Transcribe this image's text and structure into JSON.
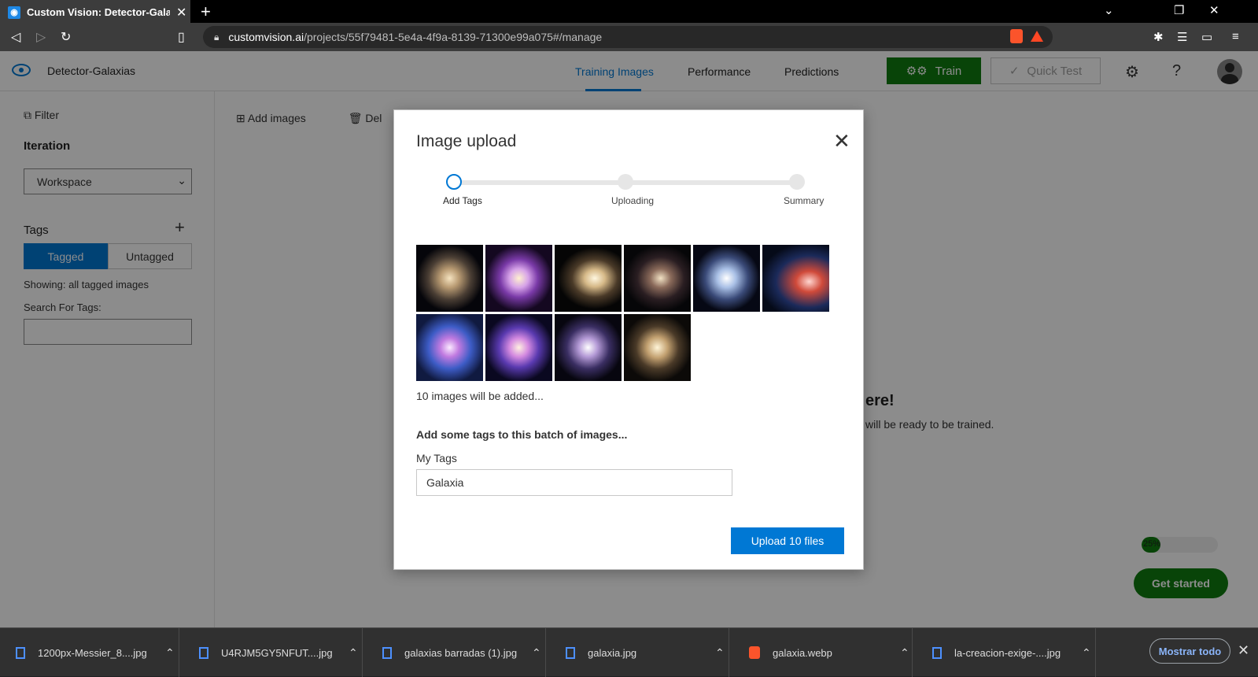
{
  "browser": {
    "tab_title": "Custom Vision: Detector-Galaxias",
    "url_host": "customvision.ai",
    "url_path": "/projects/55f79481-5e4a-4f9a-8139-71300e99a075#/manage"
  },
  "app": {
    "project_name": "Detector-Galaxias",
    "nav": [
      {
        "label": "Training Images",
        "active": true
      },
      {
        "label": "Performance",
        "active": false
      },
      {
        "label": "Predictions",
        "active": false
      }
    ],
    "train_label": "Train",
    "quick_test_label": "Quick Test"
  },
  "sidebar": {
    "filter_label": "Filter",
    "iteration_heading": "Iteration",
    "iteration_value": "Workspace",
    "tags_heading": "Tags",
    "tagged_label": "Tagged",
    "untagged_label": "Untagged",
    "showing_text": "Showing: all tagged images",
    "search_label": "Search For Tags:"
  },
  "content": {
    "add_images_label": "Add images",
    "delete_label": "Del",
    "bg_heading": "ere!",
    "bg_sub": "will be ready to be trained.",
    "progress_label": "25%",
    "progress_value": 0.25,
    "get_started_label": "Get started"
  },
  "modal": {
    "title": "Image upload",
    "steps": [
      {
        "label": "Add Tags",
        "active": true
      },
      {
        "label": "Uploading",
        "active": false
      },
      {
        "label": "Summary",
        "active": false
      }
    ],
    "thumbnails": [
      "galaxy-thumb",
      "galaxy-thumb",
      "galaxy-thumb",
      "galaxy-thumb",
      "galaxy-thumb",
      "galaxy-thumb",
      "galaxy-thumb",
      "galaxy-thumb",
      "galaxy-thumb",
      "galaxy-thumb"
    ],
    "count_text": "10 images will be added...",
    "batch_text": "Add some tags to this batch of images...",
    "my_tags_label": "My Tags",
    "tag_value": "Galaxia",
    "upload_label": "Upload 10 files"
  },
  "downloads": {
    "items": [
      {
        "name": "1200px-Messier_8....jpg",
        "icon": "image-file-icon"
      },
      {
        "name": "U4RJM5GY5NFUT....jpg",
        "icon": "image-file-icon"
      },
      {
        "name": "galaxias barradas (1).jpg",
        "icon": "image-file-icon"
      },
      {
        "name": "galaxia.jpg",
        "icon": "image-file-icon"
      },
      {
        "name": "galaxia.webp",
        "icon": "brave-file-icon"
      },
      {
        "name": "la-creacion-exige-....jpg",
        "icon": "image-file-icon"
      }
    ],
    "show_all_label": "Mostrar todo"
  },
  "colors": {
    "accent": "#0078d4",
    "train_green": "#107c10"
  }
}
